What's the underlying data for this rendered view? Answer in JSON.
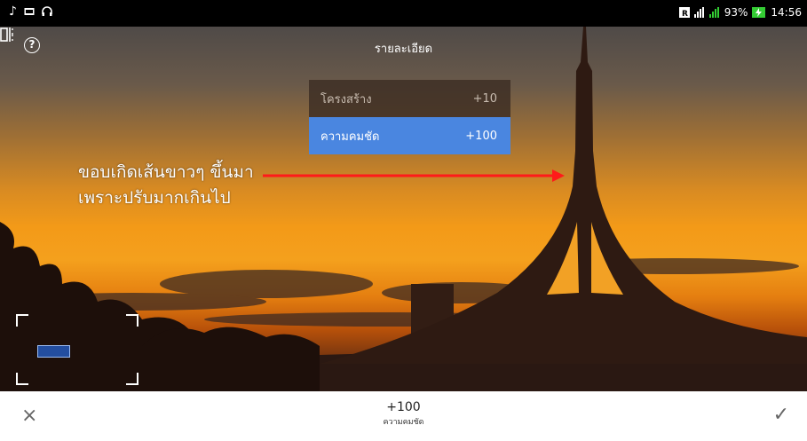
{
  "status_bar": {
    "battery": "93%",
    "time": "14:56"
  },
  "header": {
    "title": "รายละเอียด"
  },
  "icons": {
    "help": "?",
    "music": "♪",
    "image": "image-icon",
    "headset": "headset-icon",
    "compare": "compare-icon"
  },
  "adjustments": [
    {
      "label": "โครงสร้าง",
      "value": "+10",
      "selected": false
    },
    {
      "label": "ความคมชัด",
      "value": "+100",
      "selected": true
    }
  ],
  "annotation": {
    "line1": "ขอบเกิดเส้นขาวๆ  ขึ้นมา",
    "line2": "เพราะปรับมากเกินไป",
    "arrow_color": "#ff1a1a"
  },
  "bottom": {
    "cancel": "×",
    "apply": "✓",
    "value": "+100",
    "label": "ความคมชัด"
  },
  "colors": {
    "accent": "#4a86e0",
    "status_bg": "#000000"
  }
}
